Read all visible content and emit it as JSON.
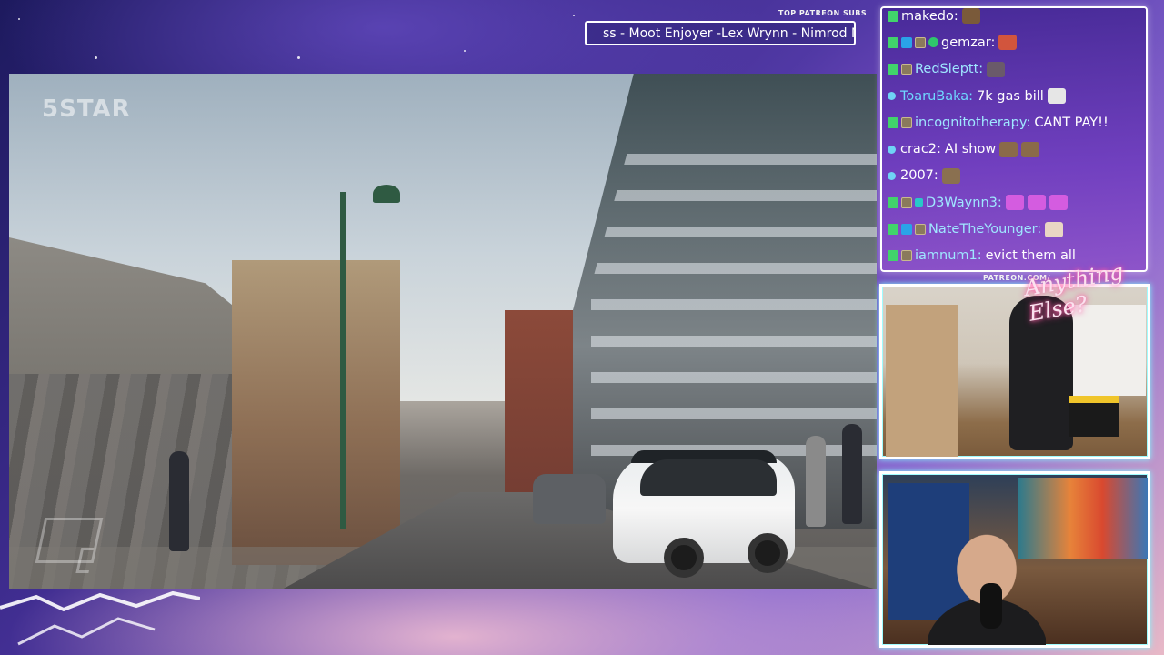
{
  "video": {
    "watermark_top_left": "5STAR"
  },
  "ticker": {
    "title": "TOP PATREON SUBS",
    "text": "ss - Moot Enjoyer -Lex Wrynn - Nimrod Ni"
  },
  "chat": {
    "messages": [
      {
        "user": "makedo:",
        "text": "",
        "user_color": "#ffffff",
        "badges": [
          "k"
        ],
        "emotes": [
          "#7a5a3a"
        ]
      },
      {
        "user": "gemzar:",
        "text": "",
        "user_color": "#ffffff",
        "badges": [
          "k",
          "prime",
          "sub",
          "hex"
        ],
        "emotes": [
          "#d2553d"
        ]
      },
      {
        "user": "RedSleptt:",
        "text": "",
        "user_color": "#9fe7ff",
        "badges": [
          "k",
          "sub"
        ],
        "emotes": [
          "#6a5a6a"
        ]
      },
      {
        "user": "ToaruBaka:",
        "text": "7k gas bill",
        "user_color": "#6fd8ff",
        "badges": [
          "dot"
        ],
        "emotes": [
          "#e6e6e6"
        ]
      },
      {
        "user": "incognitotherapy:",
        "text": "CANT PAY!!",
        "user_color": "#9fe7ff",
        "badges": [
          "k",
          "sub"
        ],
        "emotes": []
      },
      {
        "user": "crac2:",
        "text": "AI show",
        "user_color": "#ffffff",
        "badges": [
          "dot"
        ],
        "emotes": [
          "#8a6a4a",
          "#8a6a4a"
        ]
      },
      {
        "user": "2007:",
        "text": "",
        "user_color": "#ffffff",
        "badges": [
          "dot"
        ],
        "emotes": [
          "#8a7050"
        ]
      },
      {
        "user": "D3Waynn3:",
        "text": "",
        "user_color": "#9fe7ff",
        "badges": [
          "k",
          "sub",
          "mod"
        ],
        "emotes": [
          "#d45ce0",
          "#d45ce0",
          "#d45ce0"
        ]
      },
      {
        "user": "NateTheYounger:",
        "text": "",
        "user_color": "#9fe7ff",
        "badges": [
          "k",
          "prime",
          "sub"
        ],
        "emotes": [
          "#e9d6c4"
        ]
      },
      {
        "user": "iamnum1:",
        "text": "evict them all",
        "user_color": "#9fe7ff",
        "badges": [
          "k",
          "sub"
        ],
        "emotes": []
      }
    ]
  },
  "webcams": {
    "label": "PATREON.COM/",
    "brand": "Anything Else?"
  },
  "colors": {
    "frame_glow": "#7ff7ff",
    "brand_glow": "#ff3a96"
  }
}
